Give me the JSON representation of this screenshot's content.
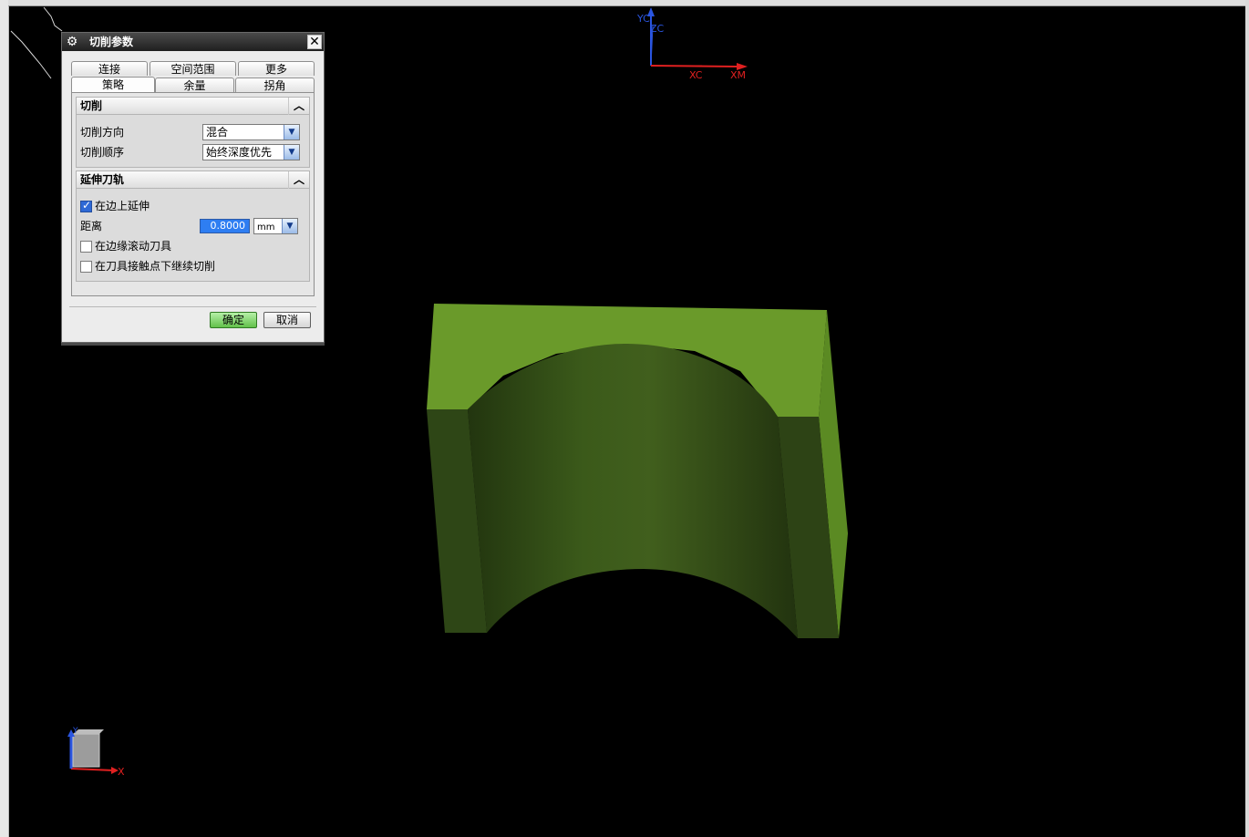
{
  "dialog": {
    "title": "切削参数",
    "tabs_row1": [
      "连接",
      "空间范围",
      "更多"
    ],
    "tabs_row2": [
      "策略",
      "余量",
      "拐角"
    ],
    "active_tab": "策略",
    "cut_group": {
      "header": "切削",
      "cut_direction_label": "切削方向",
      "cut_direction_value": "混合",
      "cut_order_label": "切削顺序",
      "cut_order_value": "始终深度优先"
    },
    "extend_group": {
      "header": "延伸刀轨",
      "extend_on_edge_label": "在边上延伸",
      "extend_on_edge_checked": true,
      "distance_label": "距离",
      "distance_value": "0.8000",
      "distance_unit": "mm",
      "roll_tool_label": "在边缘滚动刀具",
      "roll_tool_checked": false,
      "continue_cut_label": "在刀具接触点下继续切削",
      "continue_cut_checked": false
    },
    "ok_label": "确定",
    "cancel_label": "取消"
  },
  "wcs_triad": {
    "y": "YC",
    "z": "ZC",
    "x": "XC",
    "xm": "XM"
  },
  "view_triad": {
    "y": "Y",
    "x": "X"
  },
  "colors": {
    "part_top": "#6b9a2c",
    "part_side": "#2e4217",
    "axis_x": "#e02020",
    "axis_y_z": "#2050e0"
  }
}
